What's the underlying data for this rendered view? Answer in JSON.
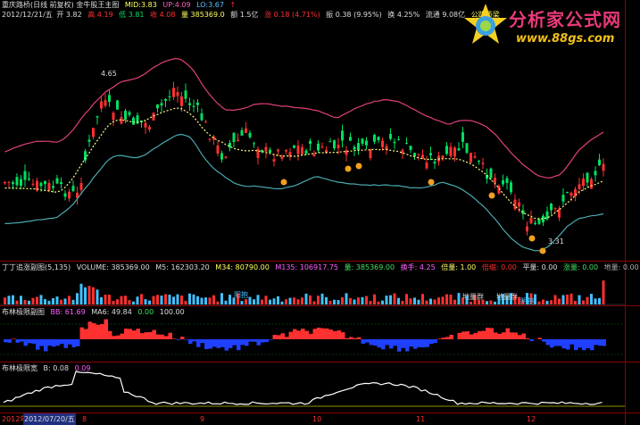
{
  "header_row1": {
    "title": "重庆路桥(日线 前复权) 金牛股王主图",
    "mid_label": "MID:",
    "mid_value": "3.83",
    "up_label": "UP:",
    "up_value": "4.09",
    "lo_label": "LO:",
    "lo_value": "3.67",
    "up_arrow": "↑"
  },
  "header_row2": {
    "date": "2012/12/21/五",
    "open": "开 3.82",
    "high": "高 4.19",
    "low": "低 3.81",
    "close": "收 4.08",
    "volume": "量 385369.0",
    "amount": "额 1.5亿",
    "change": "涨 0.18 (4.71%)",
    "amplitude": "振 0.38 (9.95%)",
    "turnover": "换 4.25%",
    "float": "流通 9.08亿",
    "sector": "公路桥梁"
  },
  "volume_header": {
    "title": "丁丁追涨副图(5,135)",
    "volume": "VOLUME: 385369.00",
    "m5": "M5: 162303.20",
    "m34": "M34: 80790.00",
    "m135": "M135: 106917.75",
    "liang": "量: 385369.00",
    "huanshou": "换手: 4.25",
    "beiliang": "倍量: 1.00",
    "beiliang2": "倍缩: 0.00",
    "pingliang": "平量: 0.00",
    "zhangliang": "涨量: 0.00",
    "diliang": "地量: 0.00"
  },
  "boll_header": {
    "title": "布林极限副图",
    "bb": "BB: 61.69",
    "ma6": "MA6: 49.84",
    "zero": "0.00",
    "hundred": "100.00"
  },
  "boll_width_header": {
    "title": "布林极限宽",
    "b": "B: 0.08",
    "b2": "0.09"
  },
  "annotations": {
    "high_mark": "4.65",
    "low_mark": "3.31",
    "diliang_1": "地量群",
    "diliang_2": "地量群",
    "yangbao": "阳抱",
    "yinbao": "阴抱"
  },
  "logo": {
    "title": "分析家公式网",
    "url": "www.88gs.com"
  },
  "x_axis": {
    "labels": [
      "2012年",
      "2012/07/20/五",
      "8",
      "9",
      "10",
      "11",
      "12"
    ]
  },
  "colors": {
    "up": "#ff3030",
    "down": "#00e060",
    "upper_band": "#e0407a",
    "lower_band": "#4aa8b0",
    "mid_band": "#ffff80",
    "volume_up": "#ff3030",
    "volume_down": "#40c0ff"
  }
}
